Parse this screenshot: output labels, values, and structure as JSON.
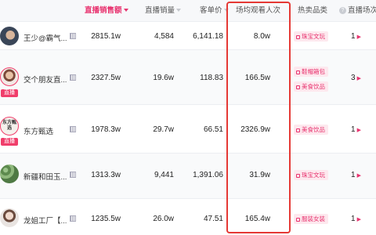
{
  "header": {
    "sales_label": "直播销售额",
    "volume_label": "直播销量",
    "price_label": "客单价",
    "viewers_label": "场均观看人次",
    "category_label": "热卖品类",
    "sessions_label": "直播场次"
  },
  "rows": [
    {
      "name": "王少@霸气...",
      "sales": "2815.1w",
      "volume": "4,584",
      "price": "6,141.18",
      "viewers": "8.0w",
      "tags": [
        "珠宝文玩"
      ],
      "sessions": "1",
      "live": false
    },
    {
      "name": "交个朋友直...",
      "sales": "2327.5w",
      "volume": "19.6w",
      "price": "118.83",
      "viewers": "166.5w",
      "tags": [
        "鞋帽箱包",
        "美食饮品"
      ],
      "sessions": "3",
      "live": true
    },
    {
      "name": "东方甄选",
      "sales": "1978.3w",
      "volume": "29.7w",
      "price": "66.51",
      "viewers": "2326.9w",
      "tags": [
        "美食饮品"
      ],
      "sessions": "1",
      "live": true
    },
    {
      "name": "新疆和田玉...",
      "sales": "1313.3w",
      "volume": "9,441",
      "price": "1,391.06",
      "viewers": "31.9w",
      "tags": [
        "珠宝文玩"
      ],
      "sessions": "1",
      "live": false
    },
    {
      "name": "龙姐工厂【...",
      "sales": "1235.5w",
      "volume": "26.0w",
      "price": "47.51",
      "viewers": "165.4w",
      "tags": [
        "服装女装"
      ],
      "sessions": "1",
      "live": false
    }
  ],
  "live_badge": "直播",
  "avatar_text_row3": "东方甄选",
  "colors": {
    "accent": "#e8336f",
    "highlight": "#e53935"
  }
}
